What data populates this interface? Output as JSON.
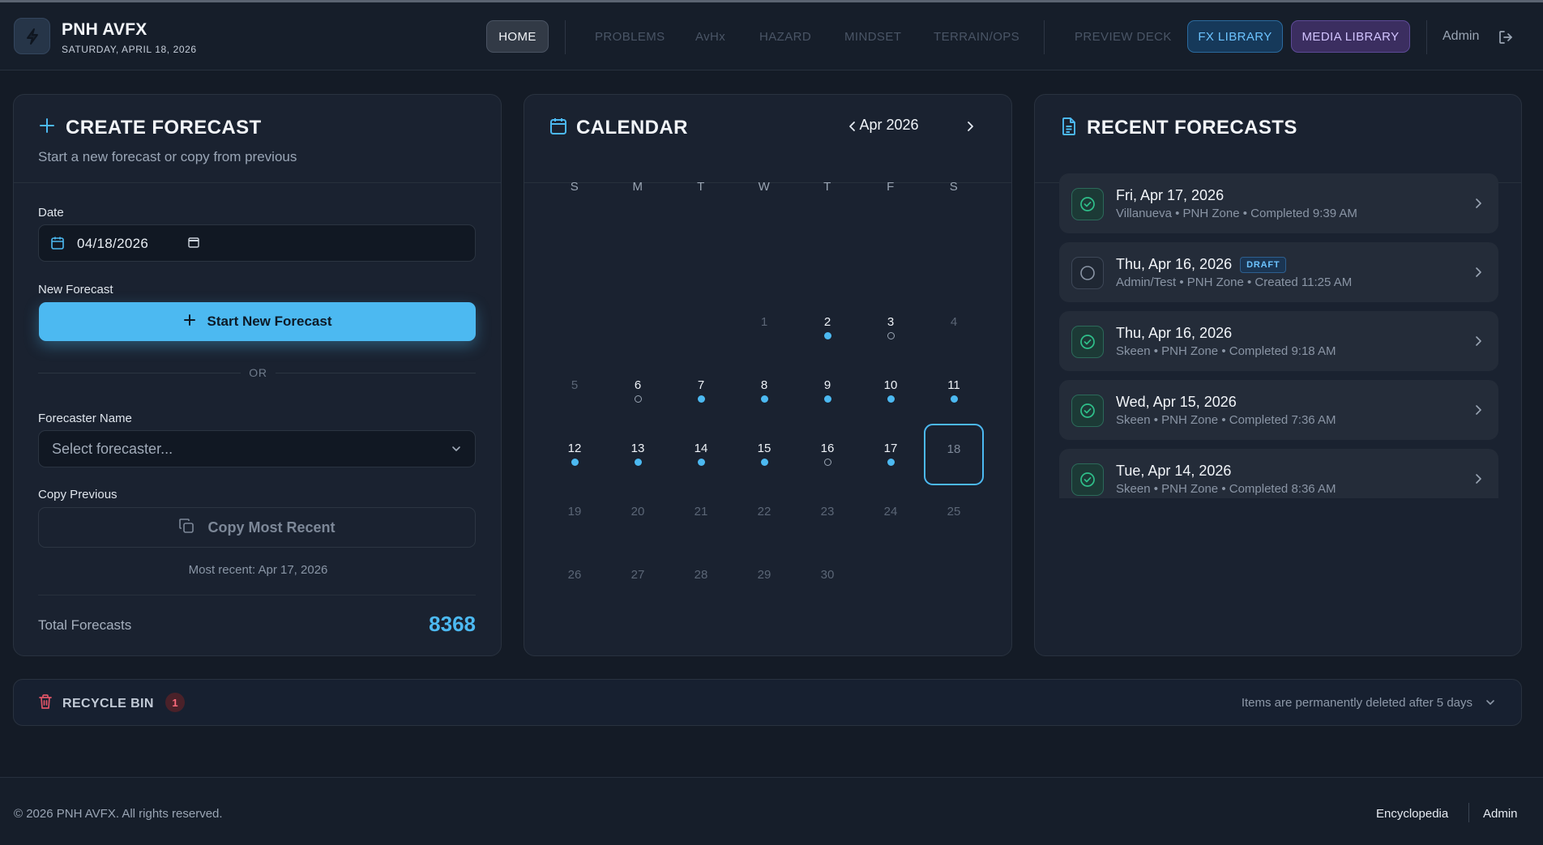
{
  "app": {
    "name": "PNH AVFX",
    "date": "SATURDAY, APRIL 18, 2026"
  },
  "nav": {
    "home": "HOME",
    "problems": "PROBLEMS",
    "avhx": "AvHx",
    "hazard": "HAZARD",
    "mindset": "MINDSET",
    "terrain": "TERRAIN/OPS",
    "preview": "PREVIEW DECK",
    "fx_library": "FX LIBRARY",
    "media_library": "MEDIA LIBRARY",
    "admin": "Admin"
  },
  "create": {
    "title": "CREATE FORECAST",
    "subtitle": "Start a new forecast or copy from previous",
    "date_label": "Date",
    "date_value": "04/18/2026",
    "new_label": "New Forecast",
    "start_button": "Start New Forecast",
    "or": "OR",
    "forecaster_label": "Forecaster Name",
    "forecaster_placeholder": "Select forecaster...",
    "copy_label": "Copy Previous",
    "copy_button": "Copy Most Recent",
    "most_recent": "Most recent: Apr 17, 2026",
    "total_label": "Total Forecasts",
    "total_value": "8368"
  },
  "calendar": {
    "title": "CALENDAR",
    "month": "Apr 2026",
    "weekdays": [
      "S",
      "M",
      "T",
      "W",
      "T",
      "F",
      "S"
    ],
    "first_weekday": 3,
    "today": 18,
    "days": [
      {
        "d": "1",
        "mark": "none"
      },
      {
        "d": "2",
        "mark": "filled"
      },
      {
        "d": "3",
        "mark": "hollow"
      },
      {
        "d": "4",
        "mark": "none"
      },
      {
        "d": "5",
        "mark": "none"
      },
      {
        "d": "6",
        "mark": "hollow"
      },
      {
        "d": "7",
        "mark": "filled"
      },
      {
        "d": "8",
        "mark": "filled"
      },
      {
        "d": "9",
        "mark": "filled"
      },
      {
        "d": "10",
        "mark": "filled"
      },
      {
        "d": "11",
        "mark": "filled"
      },
      {
        "d": "12",
        "mark": "filled"
      },
      {
        "d": "13",
        "mark": "filled"
      },
      {
        "d": "14",
        "mark": "filled"
      },
      {
        "d": "15",
        "mark": "filled"
      },
      {
        "d": "16",
        "mark": "hollow"
      },
      {
        "d": "17",
        "mark": "filled"
      },
      {
        "d": "18",
        "mark": "none"
      },
      {
        "d": "19",
        "mark": "none"
      },
      {
        "d": "20",
        "mark": "none"
      },
      {
        "d": "21",
        "mark": "none"
      },
      {
        "d": "22",
        "mark": "none"
      },
      {
        "d": "23",
        "mark": "none"
      },
      {
        "d": "24",
        "mark": "none"
      },
      {
        "d": "25",
        "mark": "none"
      },
      {
        "d": "26",
        "mark": "none"
      },
      {
        "d": "27",
        "mark": "none"
      },
      {
        "d": "28",
        "mark": "none"
      },
      {
        "d": "29",
        "mark": "none"
      },
      {
        "d": "30",
        "mark": "none"
      }
    ]
  },
  "recent": {
    "title": "RECENT FORECASTS",
    "items": [
      {
        "date": "Fri, Apr 17, 2026",
        "meta": "Villanueva • PNH Zone • Completed 9:39 AM",
        "status": "done",
        "badge": ""
      },
      {
        "date": "Thu, Apr 16, 2026",
        "meta": "Admin/Test • PNH Zone • Created 11:25 AM",
        "status": "draft",
        "badge": "DRAFT"
      },
      {
        "date": "Thu, Apr 16, 2026",
        "meta": "Skeen • PNH Zone • Completed 9:18 AM",
        "status": "done",
        "badge": ""
      },
      {
        "date": "Wed, Apr 15, 2026",
        "meta": "Skeen • PNH Zone • Completed 7:36 AM",
        "status": "done",
        "badge": ""
      },
      {
        "date": "Tue, Apr 14, 2026",
        "meta": "Skeen • PNH Zone • Completed 8:36 AM",
        "status": "done",
        "badge": ""
      }
    ]
  },
  "recycle": {
    "label": "RECYCLE BIN",
    "count": "1",
    "note": "Items are permanently deleted after 5 days"
  },
  "footer": {
    "copyright": "© 2026 PNH AVFX. All rights reserved.",
    "encyclopedia": "Encyclopedia",
    "admin": "Admin"
  },
  "colors": {
    "accent": "#4cb9f1",
    "success": "#2fbf8a",
    "danger": "#ff6b7d",
    "media": "#d2c4ff"
  },
  "icons": {
    "logo": "lightning-logo-icon",
    "logout": "logout-icon",
    "plus": "plus-icon",
    "calendar": "calendar-icon",
    "document": "document-icon",
    "trash": "trash-icon",
    "check": "check-circle-icon",
    "draft": "empty-circle-icon",
    "copy": "copy-icon",
    "chevron": "chevron-icon"
  }
}
